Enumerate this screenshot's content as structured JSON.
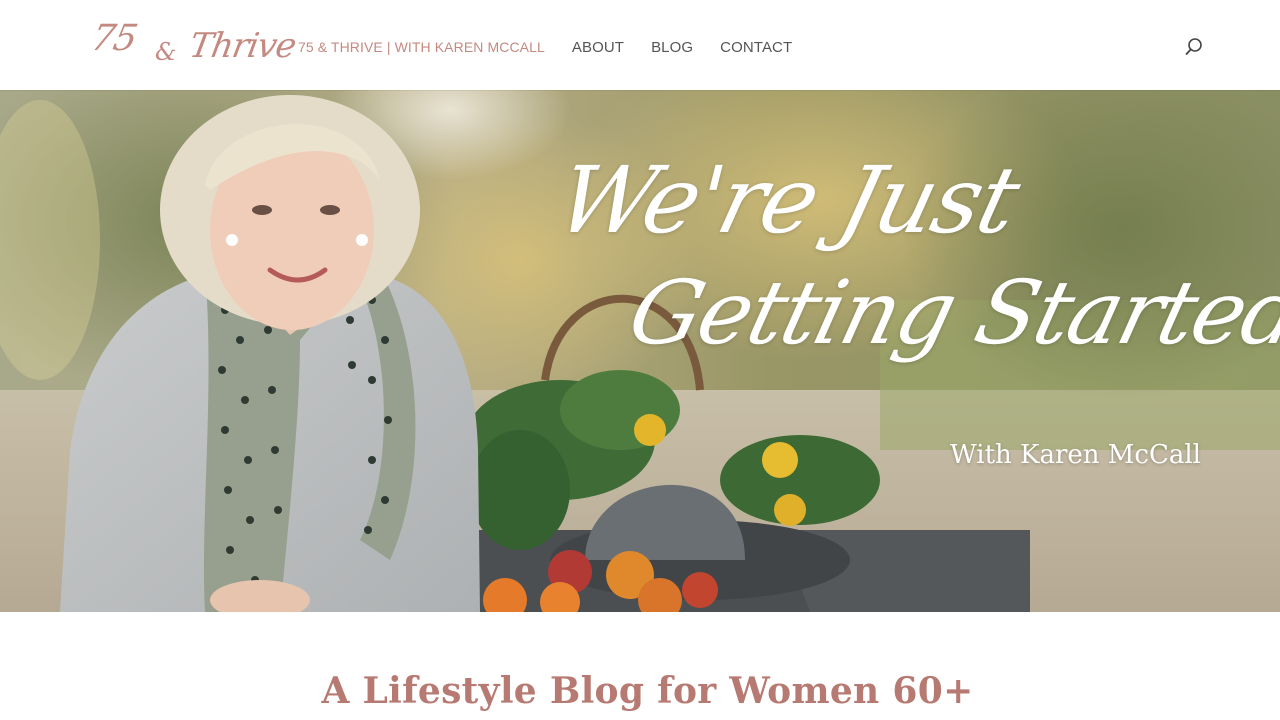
{
  "brand": {
    "logo_75": "75",
    "logo_amp": "&",
    "logo_thrive": "Thrive",
    "accent_color": "#c48a82"
  },
  "nav": {
    "items": [
      {
        "label": "75 & THRIVE | WITH KAREN MCCALL",
        "active": true
      },
      {
        "label": "ABOUT",
        "active": false
      },
      {
        "label": "BLOG",
        "active": false
      },
      {
        "label": "CONTACT",
        "active": false
      }
    ],
    "search_icon": "search-icon"
  },
  "hero": {
    "headline_line1": "We're Just",
    "headline_line2": "Getting Started.",
    "subline": "With Karen McCall"
  },
  "tagline": "A Lifestyle Blog for Women 60+"
}
